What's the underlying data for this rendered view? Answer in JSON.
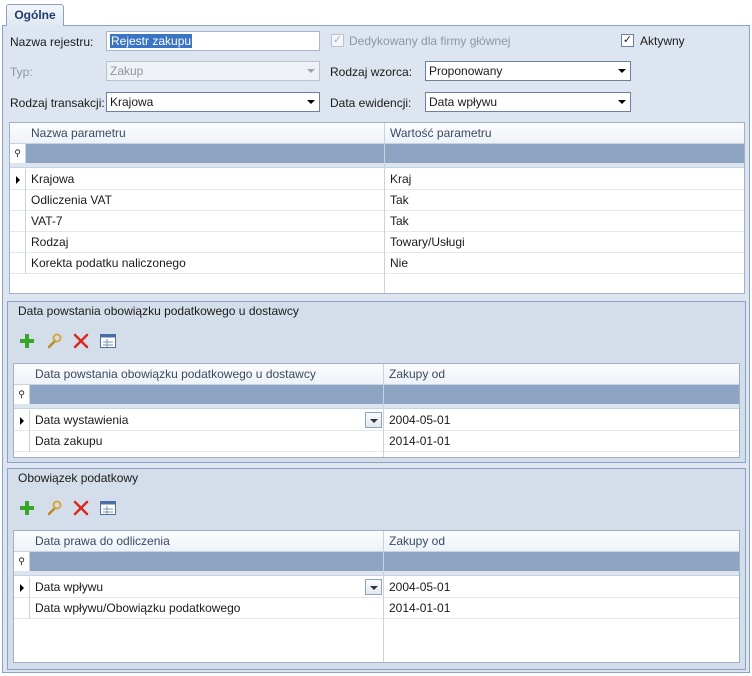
{
  "tab": {
    "label": "Ogólne"
  },
  "form": {
    "register_name_label": "Nazwa rejestru:",
    "register_name_value": "Rejestr zakupu",
    "dedicated_label": "Dedykowany dla firmy głównej",
    "active_label": "Aktywny",
    "type_label": "Typ:",
    "type_value": "Zakup",
    "pattern_type_label": "Rodzaj wzorca:",
    "pattern_type_value": "Proponowany",
    "transaction_type_label": "Rodzaj transakcji:",
    "transaction_type_value": "Krajowa",
    "record_date_label": "Data ewidencji:",
    "record_date_value": "Data wpływu"
  },
  "params_grid": {
    "columns": [
      "Nazwa parametru",
      "Wartość parametru"
    ],
    "rows": [
      {
        "name": "Krajowa",
        "value": "Kraj"
      },
      {
        "name": "Odliczenia VAT",
        "value": "Tak"
      },
      {
        "name": "VAT-7",
        "value": "Tak"
      },
      {
        "name": "Rodzaj",
        "value": "Towary/Usługi"
      },
      {
        "name": "Korekta podatku naliczonego",
        "value": "Nie"
      }
    ]
  },
  "supplier_group": {
    "title": "Data powstania obowiązku podatkowego u dostawcy",
    "columns": [
      "Data powstania obowiązku podatkowego u dostawcy",
      "Zakupy od"
    ],
    "rows": [
      {
        "name": "Data wystawienia",
        "value": "2004-05-01"
      },
      {
        "name": "Data zakupu",
        "value": "2014-01-01"
      }
    ]
  },
  "tax_group": {
    "title": "Obowiązek podatkowy",
    "columns": [
      "Data prawa do odliczenia",
      "Zakupy od"
    ],
    "rows": [
      {
        "name": "Data wpływu",
        "value": "2004-05-01"
      },
      {
        "name": "Data wpływu/Obowiązku podatkowego",
        "value": "2014-01-01"
      }
    ]
  },
  "icons": {
    "add": "plus-icon",
    "edit": "wrench-icon",
    "delete": "delete-x-icon",
    "export": "grid-export-icon"
  },
  "colors": {
    "panel_bg": "#dde5f0",
    "group_bg": "#d4ddea",
    "filter_row": "#8ea4c3",
    "selection": "#3a74c5",
    "add_green": "#3aa52b",
    "delete_red": "#d8291f"
  }
}
